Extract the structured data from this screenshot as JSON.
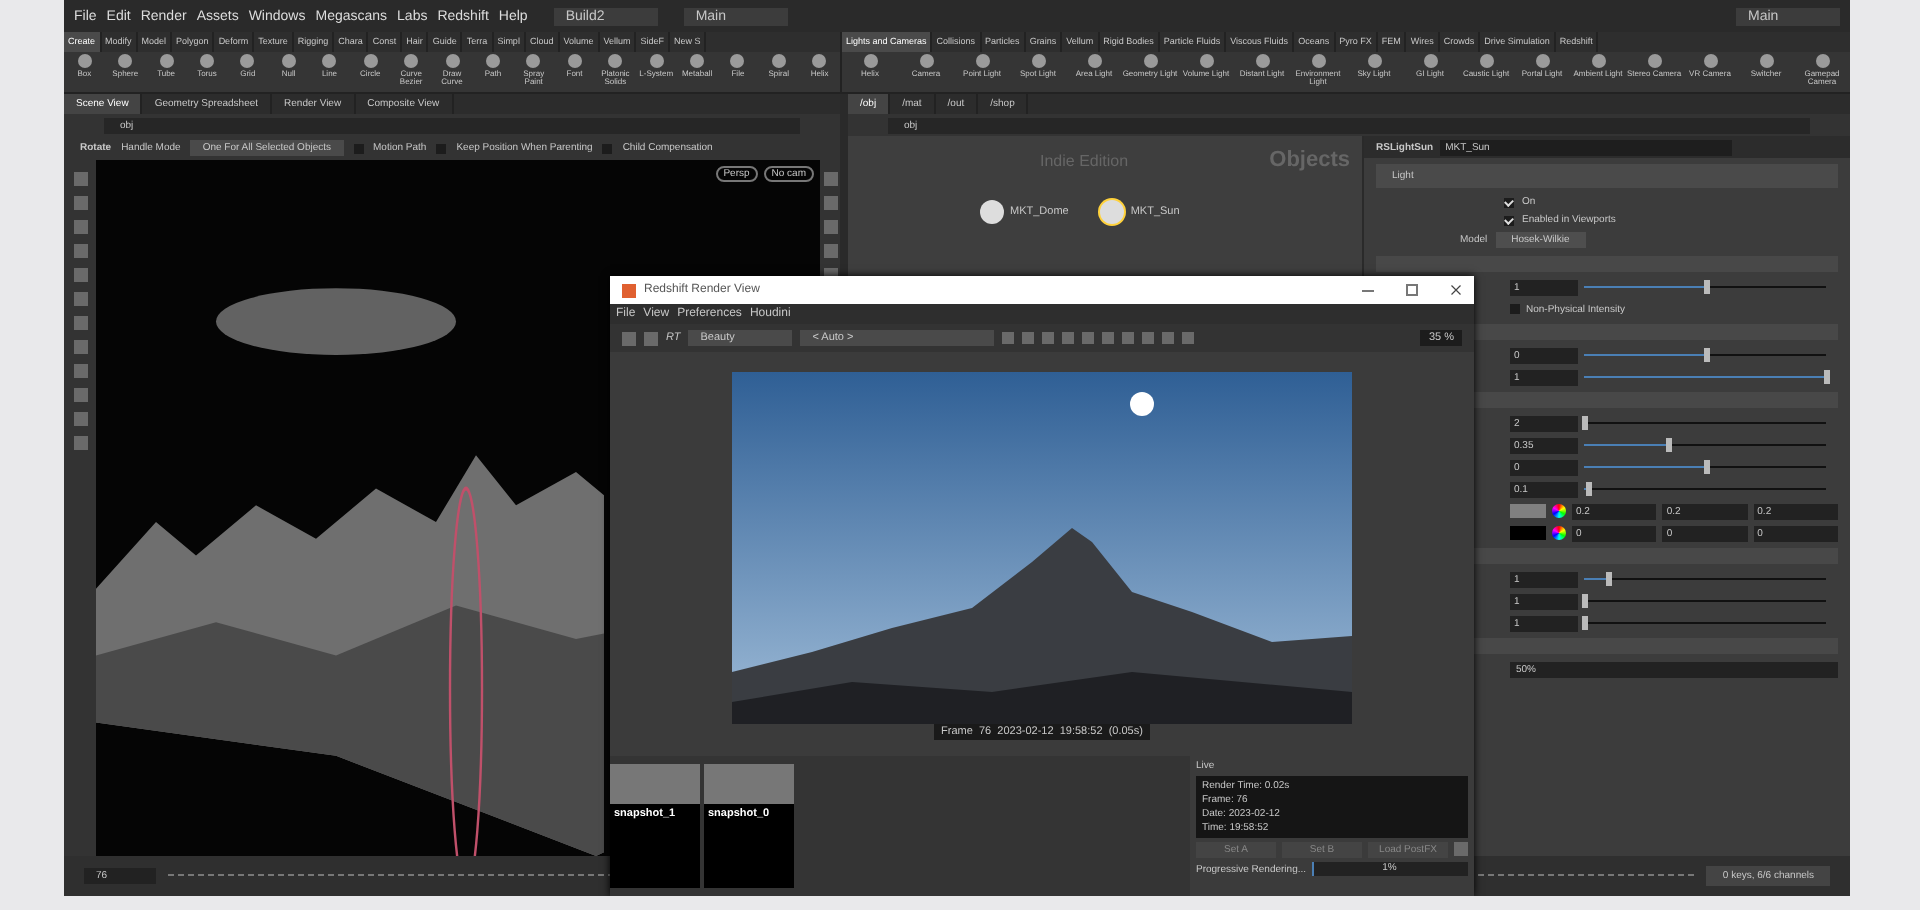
{
  "menubar": {
    "items": [
      "File",
      "Edit",
      "Render",
      "Assets",
      "Windows",
      "Megascans",
      "Labs",
      "Redshift",
      "Help"
    ],
    "desktop": "Build2",
    "workspace": "Main",
    "workspace_right": "Main"
  },
  "shelf_left": {
    "tabs": [
      {
        "label": "Create",
        "selected": true
      },
      {
        "label": "Modify",
        "selected": false
      },
      {
        "label": "Model",
        "selected": false
      },
      {
        "label": "Polygon",
        "selected": false
      },
      {
        "label": "Deform",
        "selected": false
      },
      {
        "label": "Texture",
        "selected": false
      },
      {
        "label": "Rigging",
        "selected": false
      },
      {
        "label": "Chara",
        "selected": false
      },
      {
        "label": "Const",
        "selected": false
      },
      {
        "label": "Hair",
        "selected": false
      },
      {
        "label": "Guide",
        "selected": false
      },
      {
        "label": "Terra",
        "selected": false
      },
      {
        "label": "Simpl",
        "selected": false
      },
      {
        "label": "Cloud",
        "selected": false
      },
      {
        "label": "Volume",
        "selected": false
      },
      {
        "label": "Vellum",
        "selected": false
      },
      {
        "label": "SideF",
        "selected": false
      },
      {
        "label": "New S",
        "selected": false
      }
    ],
    "tools": [
      "Box",
      "Sphere",
      "Tube",
      "Torus",
      "Grid",
      "Null",
      "Line",
      "Circle",
      "Curve Bezier",
      "Draw Curve",
      "Path",
      "Spray Paint",
      "Font",
      "Platonic Solids",
      "L-System",
      "Metaball",
      "File",
      "Spiral",
      "Helix"
    ]
  },
  "shelf_right": {
    "tabs": [
      {
        "label": "Lights and Cameras",
        "selected": true
      },
      {
        "label": "Collisions",
        "selected": false
      },
      {
        "label": "Particles",
        "selected": false
      },
      {
        "label": "Grains",
        "selected": false
      },
      {
        "label": "Vellum",
        "selected": false
      },
      {
        "label": "Rigid Bodies",
        "selected": false
      },
      {
        "label": "Particle Fluids",
        "selected": false
      },
      {
        "label": "Viscous Fluids",
        "selected": false
      },
      {
        "label": "Oceans",
        "selected": false
      },
      {
        "label": "Pyro FX",
        "selected": false
      },
      {
        "label": "FEM",
        "selected": false
      },
      {
        "label": "Wires",
        "selected": false
      },
      {
        "label": "Crowds",
        "selected": false
      },
      {
        "label": "Drive Simulation",
        "selected": false
      },
      {
        "label": "Redshift",
        "selected": false
      }
    ],
    "tools": [
      "Helix",
      "Camera",
      "Point Light",
      "Spot Light",
      "Area Light",
      "Geometry Light",
      "Volume Light",
      "Distant Light",
      "Environment Light",
      "Sky Light",
      "GI Light",
      "Caustic Light",
      "Portal Light",
      "Ambient Light",
      "Stereo Camera",
      "VR Camera",
      "Switcher",
      "Gamepad Camera"
    ]
  },
  "left_pane": {
    "tabs": [
      {
        "label": "Scene View",
        "selected": true
      },
      {
        "label": "Geometry Spreadsheet",
        "selected": false
      },
      {
        "label": "Render View",
        "selected": false
      },
      {
        "label": "Composite View",
        "selected": false
      }
    ],
    "path": "obj"
  },
  "viewport": {
    "tool": "Rotate",
    "handle_label": "Handle Mode",
    "handle_option": "One For All Selected Objects",
    "options": [
      {
        "label": "Motion Path",
        "checked": false
      },
      {
        "label": "Keep Position When Parenting",
        "checked": false
      },
      {
        "label": "Child Compensation",
        "checked": false
      }
    ],
    "camera_menus": [
      "Persp",
      "No cam"
    ]
  },
  "right_pane": {
    "tabs": [
      {
        "label": "/obj",
        "selected": true
      },
      {
        "label": "/mat",
        "selected": false
      },
      {
        "label": "/out",
        "selected": false
      },
      {
        "label": "/shop",
        "selected": false
      }
    ],
    "path": "obj"
  },
  "network": {
    "edition": "Indie Edition",
    "context": "Objects",
    "nodes": [
      {
        "name": "MKT_Dome",
        "selected": false
      },
      {
        "name": "MKT_Sun",
        "selected": true
      }
    ]
  },
  "parameters": {
    "node_type": "RSLightSun",
    "node_name": "MKT_Sun",
    "folder": "Light",
    "toggles": [
      {
        "label": "On",
        "checked": true
      },
      {
        "label": "Enabled in Viewports",
        "checked": true
      }
    ],
    "model": {
      "label": "Model",
      "value": "Hosek-Wilkie"
    },
    "groups": [
      [
        {
          "kind": "slider",
          "value": "1",
          "level": 0.5
        },
        {
          "kind": "check",
          "label": "Non-Physical Intensity",
          "checked": false
        }
      ],
      [
        {
          "kind": "slider",
          "value": "0",
          "level": 0.5
        },
        {
          "kind": "slider",
          "value": "1",
          "level": 1
        }
      ],
      [
        {
          "kind": "slider",
          "value": "2",
          "level": 0
        },
        {
          "kind": "slider",
          "value": "0.35",
          "level": 0.35
        },
        {
          "kind": "slider",
          "value": "0",
          "level": 0.5
        },
        {
          "kind": "slider",
          "value": "0.1",
          "level": 0.02
        },
        {
          "kind": "color",
          "color": "#808080",
          "values": [
            "0.2",
            "0.2",
            "0.2"
          ]
        },
        {
          "kind": "color",
          "color": "#000000",
          "values": [
            "0",
            "0",
            "0"
          ]
        }
      ],
      [
        {
          "kind": "slider",
          "value": "1",
          "level": 0.1
        },
        {
          "kind": "slider",
          "value": "1",
          "level": 0
        },
        {
          "kind": "slider",
          "value": "1",
          "level": 0
        }
      ],
      [
        {
          "kind": "text",
          "value": "50%"
        }
      ]
    ]
  },
  "render_view": {
    "title": "Redshift Render View",
    "menu": [
      "File",
      "View",
      "Preferences",
      "Houdini"
    ],
    "mode": "RT",
    "aov": "Beauty",
    "camera": "< Auto >",
    "zoom": "35 %",
    "caption": "Frame  76  2023-02-12  19:58:52  (0.05s)",
    "snapshots": [
      "snapshot_1",
      "snapshot_0"
    ],
    "live_title": "Live",
    "live_lines": [
      "Render Time: 0.02s",
      "Frame: 76",
      "Date: 2023-02-12",
      "Time: 19:58:52"
    ],
    "buttons": [
      "Set A",
      "Set B",
      "Load PostFX"
    ],
    "progress": {
      "label": "Progressive Rendering...",
      "value": "1%",
      "level": 0.01
    }
  },
  "timeline": {
    "frame": "76",
    "key_info": "0 keys, 6/6 channels"
  }
}
